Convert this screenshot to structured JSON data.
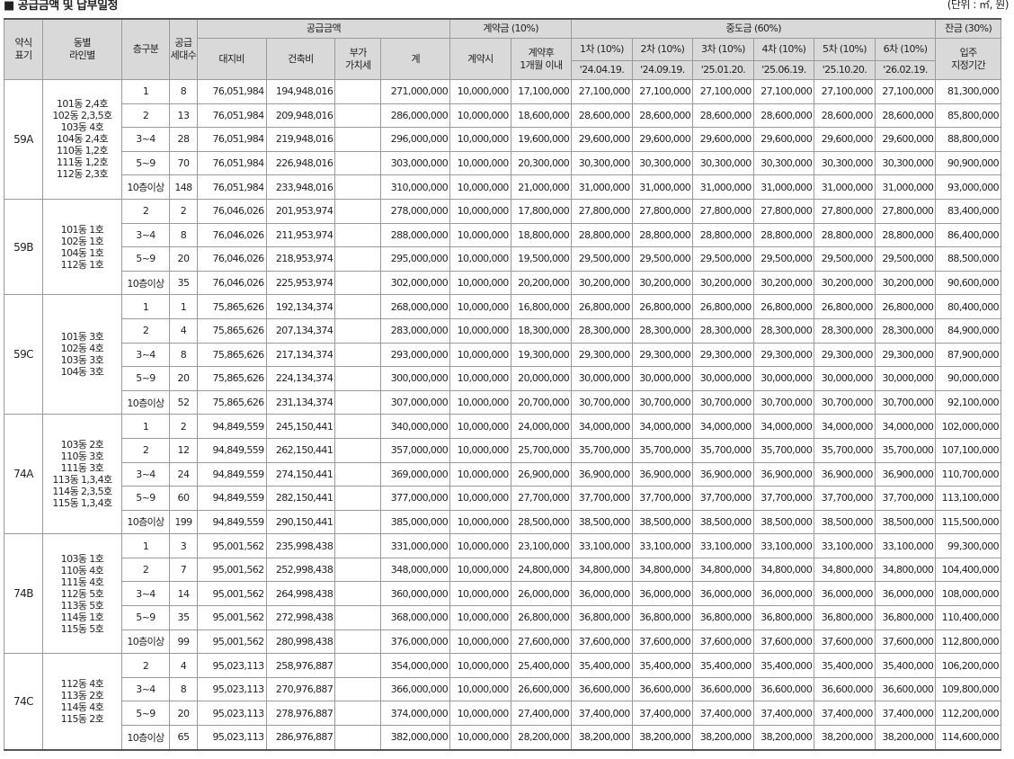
{
  "title": "■ 공급금액 및 납부일정",
  "unit": "(단위 : ㎡, 원)",
  "headers": {
    "type": [
      "약식",
      "표기"
    ],
    "dong": [
      "동별",
      "라인별"
    ],
    "floor": "층구분",
    "units": [
      "공급",
      "세대수"
    ],
    "supply": "공급금액",
    "land": "대지비",
    "building": "건축비",
    "vat": [
      "부가",
      "가치세"
    ],
    "total": "계",
    "deposit": "계약금 (10%)",
    "dep_at": "계약시",
    "dep_after": [
      "계약후",
      "1개월 이내"
    ],
    "middle": "중도금 (60%)",
    "installments": [
      {
        "label": "1차 (10%)",
        "date": "'24.04.19."
      },
      {
        "label": "2차 (10%)",
        "date": "'24.09.19."
      },
      {
        "label": "3차 (10%)",
        "date": "'25.01.20."
      },
      {
        "label": "4차 (10%)",
        "date": "'25.06.19."
      },
      {
        "label": "5차 (10%)",
        "date": "'25.10.20."
      },
      {
        "label": "6차 (10%)",
        "date": "'26.02.19."
      }
    ],
    "balance": "잔금 (30%)",
    "movein": [
      "입주",
      "지정기간"
    ]
  },
  "groups": [
    {
      "type": "59A",
      "dong": [
        "101동 2,4호",
        "102동 2,3,5호",
        "103동 4호",
        "104동 2,4호",
        "110동 1,2호",
        "111동 1,2호",
        "112동 2,3호"
      ],
      "rows": [
        {
          "floor": "1",
          "units": "8",
          "land": "76,051,984",
          "building": "194,948,016",
          "vat": "",
          "total": "271,000,000",
          "dep1": "10,000,000",
          "dep2": "17,100,000",
          "mid": "27,100,000",
          "balance": "81,300,000"
        },
        {
          "floor": "2",
          "units": "13",
          "land": "76,051,984",
          "building": "209,948,016",
          "vat": "",
          "total": "286,000,000",
          "dep1": "10,000,000",
          "dep2": "18,600,000",
          "mid": "28,600,000",
          "balance": "85,800,000"
        },
        {
          "floor": "3~4",
          "units": "28",
          "land": "76,051,984",
          "building": "219,948,016",
          "vat": "",
          "total": "296,000,000",
          "dep1": "10,000,000",
          "dep2": "19,600,000",
          "mid": "29,600,000",
          "balance": "88,800,000"
        },
        {
          "floor": "5~9",
          "units": "70",
          "land": "76,051,984",
          "building": "226,948,016",
          "vat": "",
          "total": "303,000,000",
          "dep1": "10,000,000",
          "dep2": "20,300,000",
          "mid": "30,300,000",
          "balance": "90,900,000"
        },
        {
          "floor": "10층이상",
          "units": "148",
          "land": "76,051,984",
          "building": "233,948,016",
          "vat": "",
          "total": "310,000,000",
          "dep1": "10,000,000",
          "dep2": "21,000,000",
          "mid": "31,000,000",
          "balance": "93,000,000"
        }
      ]
    },
    {
      "type": "59B",
      "dong": [
        "101동 1호",
        "102동 1호",
        "104동 1호",
        "112동 1호"
      ],
      "rows": [
        {
          "floor": "2",
          "units": "2",
          "land": "76,046,026",
          "building": "201,953,974",
          "vat": "",
          "total": "278,000,000",
          "dep1": "10,000,000",
          "dep2": "17,800,000",
          "mid": "27,800,000",
          "balance": "83,400,000"
        },
        {
          "floor": "3~4",
          "units": "8",
          "land": "76,046,026",
          "building": "211,953,974",
          "vat": "",
          "total": "288,000,000",
          "dep1": "10,000,000",
          "dep2": "18,800,000",
          "mid": "28,800,000",
          "balance": "86,400,000"
        },
        {
          "floor": "5~9",
          "units": "20",
          "land": "76,046,026",
          "building": "218,953,974",
          "vat": "",
          "total": "295,000,000",
          "dep1": "10,000,000",
          "dep2": "19,500,000",
          "mid": "29,500,000",
          "balance": "88,500,000"
        },
        {
          "floor": "10층이상",
          "units": "35",
          "land": "76,046,026",
          "building": "225,953,974",
          "vat": "",
          "total": "302,000,000",
          "dep1": "10,000,000",
          "dep2": "20,200,000",
          "mid": "30,200,000",
          "balance": "90,600,000"
        }
      ]
    },
    {
      "type": "59C",
      "dong": [
        "101동 3호",
        "102동 4호",
        "103동 3호",
        "104동 3호"
      ],
      "rows": [
        {
          "floor": "1",
          "units": "1",
          "land": "75,865,626",
          "building": "192,134,374",
          "vat": "",
          "total": "268,000,000",
          "dep1": "10,000,000",
          "dep2": "16,800,000",
          "mid": "26,800,000",
          "balance": "80,400,000"
        },
        {
          "floor": "2",
          "units": "4",
          "land": "75,865,626",
          "building": "207,134,374",
          "vat": "",
          "total": "283,000,000",
          "dep1": "10,000,000",
          "dep2": "18,300,000",
          "mid": "28,300,000",
          "balance": "84,900,000"
        },
        {
          "floor": "3~4",
          "units": "8",
          "land": "75,865,626",
          "building": "217,134,374",
          "vat": "",
          "total": "293,000,000",
          "dep1": "10,000,000",
          "dep2": "19,300,000",
          "mid": "29,300,000",
          "balance": "87,900,000"
        },
        {
          "floor": "5~9",
          "units": "20",
          "land": "75,865,626",
          "building": "224,134,374",
          "vat": "",
          "total": "300,000,000",
          "dep1": "10,000,000",
          "dep2": "20,000,000",
          "mid": "30,000,000",
          "balance": "90,000,000"
        },
        {
          "floor": "10층이상",
          "units": "52",
          "land": "75,865,626",
          "building": "231,134,374",
          "vat": "",
          "total": "307,000,000",
          "dep1": "10,000,000",
          "dep2": "20,700,000",
          "mid": "30,700,000",
          "balance": "92,100,000"
        }
      ]
    },
    {
      "type": "74A",
      "dong": [
        "103동 2호",
        "110동 3호",
        "111동 3호",
        "113동 1,3,4호",
        "114동 2,3,5호",
        "115동 1,3,4호"
      ],
      "rows": [
        {
          "floor": "1",
          "units": "2",
          "land": "94,849,559",
          "building": "245,150,441",
          "vat": "",
          "total": "340,000,000",
          "dep1": "10,000,000",
          "dep2": "24,000,000",
          "mid": "34,000,000",
          "balance": "102,000,000"
        },
        {
          "floor": "2",
          "units": "12",
          "land": "94,849,559",
          "building": "262,150,441",
          "vat": "",
          "total": "357,000,000",
          "dep1": "10,000,000",
          "dep2": "25,700,000",
          "mid": "35,700,000",
          "balance": "107,100,000"
        },
        {
          "floor": "3~4",
          "units": "24",
          "land": "94,849,559",
          "building": "274,150,441",
          "vat": "",
          "total": "369,000,000",
          "dep1": "10,000,000",
          "dep2": "26,900,000",
          "mid": "36,900,000",
          "balance": "110,700,000"
        },
        {
          "floor": "5~9",
          "units": "60",
          "land": "94,849,559",
          "building": "282,150,441",
          "vat": "",
          "total": "377,000,000",
          "dep1": "10,000,000",
          "dep2": "27,700,000",
          "mid": "37,700,000",
          "balance": "113,100,000"
        },
        {
          "floor": "10층이상",
          "units": "199",
          "land": "94,849,559",
          "building": "290,150,441",
          "vat": "",
          "total": "385,000,000",
          "dep1": "10,000,000",
          "dep2": "28,500,000",
          "mid": "38,500,000",
          "balance": "115,500,000"
        }
      ]
    },
    {
      "type": "74B",
      "dong": [
        "103동 1호",
        "110동 4호",
        "111동 4호",
        "112동 5호",
        "113동 5호",
        "114동 1호",
        "115동 5호"
      ],
      "rows": [
        {
          "floor": "1",
          "units": "3",
          "land": "95,001,562",
          "building": "235,998,438",
          "vat": "",
          "total": "331,000,000",
          "dep1": "10,000,000",
          "dep2": "23,100,000",
          "mid": "33,100,000",
          "balance": "99,300,000"
        },
        {
          "floor": "2",
          "units": "7",
          "land": "95,001,562",
          "building": "252,998,438",
          "vat": "",
          "total": "348,000,000",
          "dep1": "10,000,000",
          "dep2": "24,800,000",
          "mid": "34,800,000",
          "balance": "104,400,000"
        },
        {
          "floor": "3~4",
          "units": "14",
          "land": "95,001,562",
          "building": "264,998,438",
          "vat": "",
          "total": "360,000,000",
          "dep1": "10,000,000",
          "dep2": "26,000,000",
          "mid": "36,000,000",
          "balance": "108,000,000"
        },
        {
          "floor": "5~9",
          "units": "35",
          "land": "95,001,562",
          "building": "272,998,438",
          "vat": "",
          "total": "368,000,000",
          "dep1": "10,000,000",
          "dep2": "26,800,000",
          "mid": "36,800,000",
          "balance": "110,400,000"
        },
        {
          "floor": "10층이상",
          "units": "99",
          "land": "95,001,562",
          "building": "280,998,438",
          "vat": "",
          "total": "376,000,000",
          "dep1": "10,000,000",
          "dep2": "27,600,000",
          "mid": "37,600,000",
          "balance": "112,800,000"
        }
      ]
    },
    {
      "type": "74C",
      "dong": [
        "112동 4호",
        "113동 2호",
        "114동 4호",
        "115동 2호"
      ],
      "rows": [
        {
          "floor": "2",
          "units": "4",
          "land": "95,023,113",
          "building": "258,976,887",
          "vat": "",
          "total": "354,000,000",
          "dep1": "10,000,000",
          "dep2": "25,400,000",
          "mid": "35,400,000",
          "balance": "106,200,000"
        },
        {
          "floor": "3~4",
          "units": "8",
          "land": "95,023,113",
          "building": "270,976,887",
          "vat": "",
          "total": "366,000,000",
          "dep1": "10,000,000",
          "dep2": "26,600,000",
          "mid": "36,600,000",
          "balance": "109,800,000"
        },
        {
          "floor": "5~9",
          "units": "20",
          "land": "95,023,113",
          "building": "278,976,887",
          "vat": "",
          "total": "374,000,000",
          "dep1": "10,000,000",
          "dep2": "27,400,000",
          "mid": "37,400,000",
          "balance": "112,200,000"
        },
        {
          "floor": "10층이상",
          "units": "65",
          "land": "95,023,113",
          "building": "286,976,887",
          "vat": "",
          "total": "382,000,000",
          "dep1": "10,000,000",
          "dep2": "28,200,000",
          "mid": "38,200,000",
          "balance": "114,600,000"
        }
      ]
    }
  ]
}
